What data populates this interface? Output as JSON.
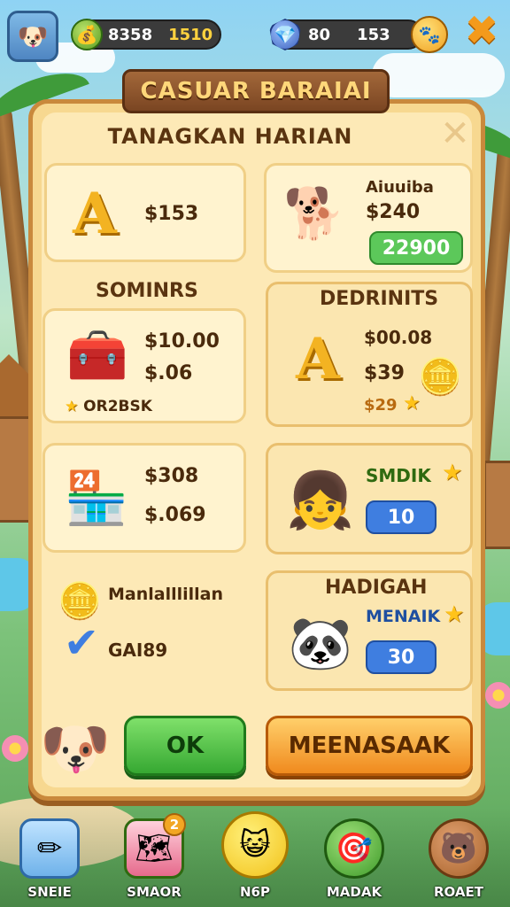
{
  "topbar": {
    "coins_value": "8358",
    "coins_gold": "1510",
    "gems_value": "80",
    "gems_secondary": "153",
    "close_glyph": "✖"
  },
  "banner": {
    "title": "CASUAR BARAIAI"
  },
  "panel": {
    "title": "TANAGKAN HARIAN",
    "close_glyph": "✕",
    "cards": {
      "c1": {
        "price": "$153",
        "label": "SOMINRS"
      },
      "c2": {
        "name": "Aiuuiba",
        "price": "$240",
        "chip": "22900"
      },
      "c3": {
        "price1": "$10.00",
        "price2": "$.06",
        "code": "OR2BSK"
      },
      "c4": {
        "label": "DEDRINITS",
        "price1": "$00.08",
        "price2": "$39",
        "price3": "$29"
      },
      "c5": {
        "price1": "$308",
        "price2": "$.069"
      },
      "c6": {
        "label": "SMDIK",
        "chip": "10"
      },
      "c7": {
        "title": "Manlalllillan",
        "code": "GAI89"
      },
      "c8": {
        "label": "HADIGAH",
        "sublabel": "MENAIK",
        "chip": "30"
      }
    },
    "ok_label": "OK",
    "secondary_label": "MEENASAAK"
  },
  "nav": {
    "items": [
      {
        "label": "SNEIE",
        "icon": "pencil-icon"
      },
      {
        "label": "SMAOR",
        "icon": "map-icon",
        "badge": "2"
      },
      {
        "label": "N6P",
        "icon": "face-icon"
      },
      {
        "label": "MADAK",
        "icon": "cannon-icon"
      },
      {
        "label": "ROAET",
        "icon": "bear-icon"
      }
    ]
  },
  "colors": {
    "panel_bg": "#fde9b6",
    "panel_border": "#c9893c",
    "ok_green": "#36a832",
    "orange": "#f08a1e",
    "chip_blue": "#3f7ee0",
    "chip_green": "#5cc85a"
  }
}
